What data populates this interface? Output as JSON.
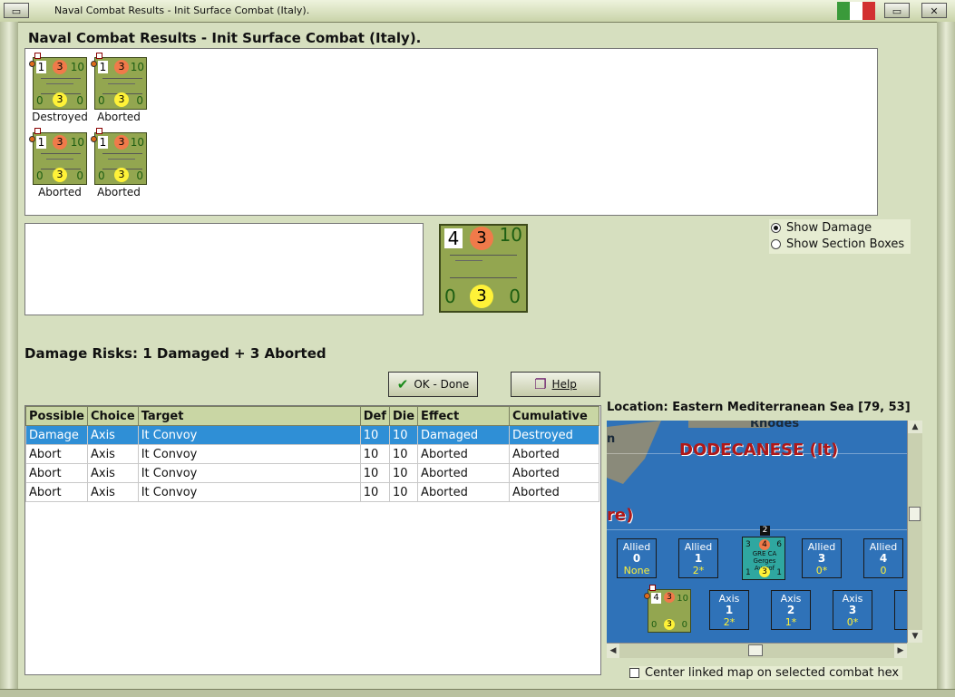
{
  "window": {
    "title": "Naval Combat Results - Init Surface Combat (Italy).",
    "min_glyph": "▭",
    "max_glyph": "▭",
    "close_glyph": "✕"
  },
  "panel_title": "Naval Combat Results - Init Surface Combat (Italy).",
  "units": [
    {
      "a": "1",
      "b": "3",
      "c": "10",
      "d": "0",
      "e": "3",
      "f": "0",
      "label": "Destroyed"
    },
    {
      "a": "1",
      "b": "3",
      "c": "10",
      "d": "0",
      "e": "3",
      "f": "0",
      "label": "Aborted"
    },
    {
      "a": "1",
      "b": "3",
      "c": "10",
      "d": "0",
      "e": "3",
      "f": "0",
      "label": "Aborted"
    },
    {
      "a": "1",
      "b": "3",
      "c": "10",
      "d": "0",
      "e": "3",
      "f": "0",
      "label": "Aborted"
    }
  ],
  "selected_unit": {
    "a": "4",
    "b": "3",
    "c": "10",
    "d": "0",
    "e": "3",
    "f": "0"
  },
  "options": {
    "show_damage": "Show Damage",
    "show_section_boxes": "Show Section Boxes",
    "selected": "show_damage"
  },
  "damage_risks": "Damage Risks:  1 Damaged + 3 Aborted",
  "buttons": {
    "ok_label": "OK - Done",
    "help_label": "Help"
  },
  "table": {
    "headers": [
      "Possible",
      "Choice",
      "Target",
      "Def",
      "Die",
      "Effect",
      "Cumulative"
    ],
    "rows": [
      [
        "Damage",
        "Axis",
        "It Convoy",
        "10",
        "10",
        "Damaged",
        "Destroyed"
      ],
      [
        "Abort",
        "Axis",
        "It Convoy",
        "10",
        "10",
        "Aborted",
        "Aborted"
      ],
      [
        "Abort",
        "Axis",
        "It Convoy",
        "10",
        "10",
        "Aborted",
        "Aborted"
      ],
      [
        "Abort",
        "Axis",
        "It Convoy",
        "10",
        "10",
        "Aborted",
        "Aborted"
      ]
    ]
  },
  "location": "Location:  Eastern Mediterranean Sea [79, 53]",
  "map": {
    "rhodes": "Rhodes",
    "n": "n",
    "dodecanese": "DODECANESE (It)",
    "re": "re)",
    "allied": [
      {
        "side": "Allied",
        "num": "0",
        "val": "None"
      },
      {
        "side": "Allied",
        "num": "1",
        "val": "2*"
      },
      {
        "side": "Allied",
        "num": "3",
        "val": "0*"
      },
      {
        "side": "Allied",
        "num": "4",
        "val": "0"
      }
    ],
    "axis": [
      {
        "side": "Axis",
        "num": "1",
        "val": "2*"
      },
      {
        "side": "Axis",
        "num": "2",
        "val": "1*"
      },
      {
        "side": "Axis",
        "num": "3",
        "val": "0*"
      }
    ],
    "allied_counter": {
      "top_flag": "2",
      "orange": "4",
      "yellow": "3",
      "tl": "3",
      "tr": "6",
      "bl": "1",
      "br": "1",
      "mid": "GRE CA Gerges Averof"
    },
    "axis_counter": {
      "a": "4",
      "b": "3",
      "c": "10",
      "d": "0",
      "e": "3",
      "f": "0"
    }
  },
  "center_linked": "Center linked map on selected combat hex"
}
